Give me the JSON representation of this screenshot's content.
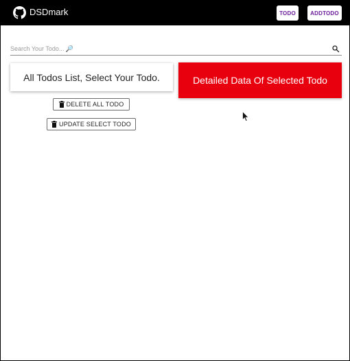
{
  "header": {
    "brand_label": "DSDmark",
    "nav": {
      "todo_label": "TODO",
      "addtodo_label": "ADDTODO"
    }
  },
  "search": {
    "placeholder": "Search Your Todo... 🔎"
  },
  "list_panel": {
    "title": "All Todos List, Select Your Todo."
  },
  "detail_panel": {
    "title": "Detailed Data Of Selected Todo",
    "color": "#e8000f"
  },
  "actions": {
    "delete_all_label": "DELETE ALL TODO",
    "update_select_label": "UPDATE SELECT TODO"
  },
  "icons": {
    "brand": "github-icon",
    "search": "search-icon",
    "trash": "trash-icon",
    "cursor": "mouse-pointer-icon"
  },
  "colors": {
    "appbar": "#000000",
    "nav_text": "#6a1b9a"
  }
}
